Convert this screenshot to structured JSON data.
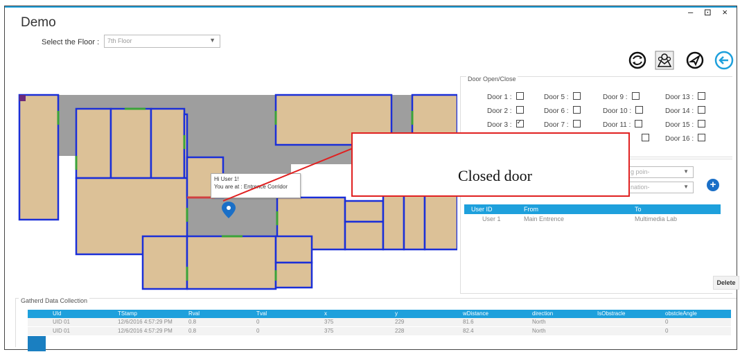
{
  "window": {
    "title": "Demo",
    "controls": "– ⊡ ×"
  },
  "floor": {
    "label": "Select the Floor :",
    "selected": "7th Floor"
  },
  "toolbar": {
    "icons": [
      "sync-icon",
      "map-users-icon",
      "navigate-icon",
      "back-arrow-icon"
    ],
    "accent": "#1ea0dc"
  },
  "map": {
    "tooltip_line1": "Hi User 1!",
    "tooltip_line2": "You are at : Entrence Corridor"
  },
  "doors": {
    "title": "Door Open/Close",
    "items": [
      {
        "label": "Door 1 :",
        "checked": false
      },
      {
        "label": "Door 2 :",
        "checked": false
      },
      {
        "label": "Door 3 :",
        "checked": true
      },
      {
        "label": "Door 5 :",
        "checked": false
      },
      {
        "label": "Door 6 :",
        "checked": false
      },
      {
        "label": "Door 7 :",
        "checked": false
      },
      {
        "label": "Door 9 :",
        "checked": false
      },
      {
        "label": "Door 10 :",
        "checked": false
      },
      {
        "label": "Door 11 :",
        "checked": false
      },
      {
        "label": "Door 13 :",
        "checked": false
      },
      {
        "label": "Door 14 :",
        "checked": false
      },
      {
        "label": "Door 15 :",
        "checked": false
      },
      {
        "label": "Door 16 :",
        "checked": false
      }
    ]
  },
  "route": {
    "start_placeholder": "g poin-",
    "dest_placeholder": "nation-",
    "headers": {
      "user": "User ID",
      "from": "From",
      "to": "To"
    },
    "rows": [
      {
        "user": "User 1",
        "from": "Main Entrence",
        "to": "Multimedia Lab"
      }
    ],
    "delete_label": "Delete"
  },
  "callout": {
    "text": "Closed door",
    "color": "#e02020"
  },
  "gathered": {
    "title": "Gatherd Data Collection",
    "headers": [
      "UId",
      "TStamp",
      "Rval",
      "Tval",
      "x",
      "y",
      "wDistance",
      "direction",
      "IsObstracle",
      "obstcleAngle"
    ],
    "rows": [
      [
        "UID 01",
        "12/6/2016 4:57:29 PM",
        "0.8",
        "0",
        "375",
        "229",
        "81.6",
        "North",
        "",
        "0"
      ],
      [
        "UID 01",
        "12/6/2016 4:57:29 PM",
        "0.8",
        "0",
        "375",
        "228",
        "82.4",
        "North",
        "",
        "0"
      ]
    ]
  }
}
